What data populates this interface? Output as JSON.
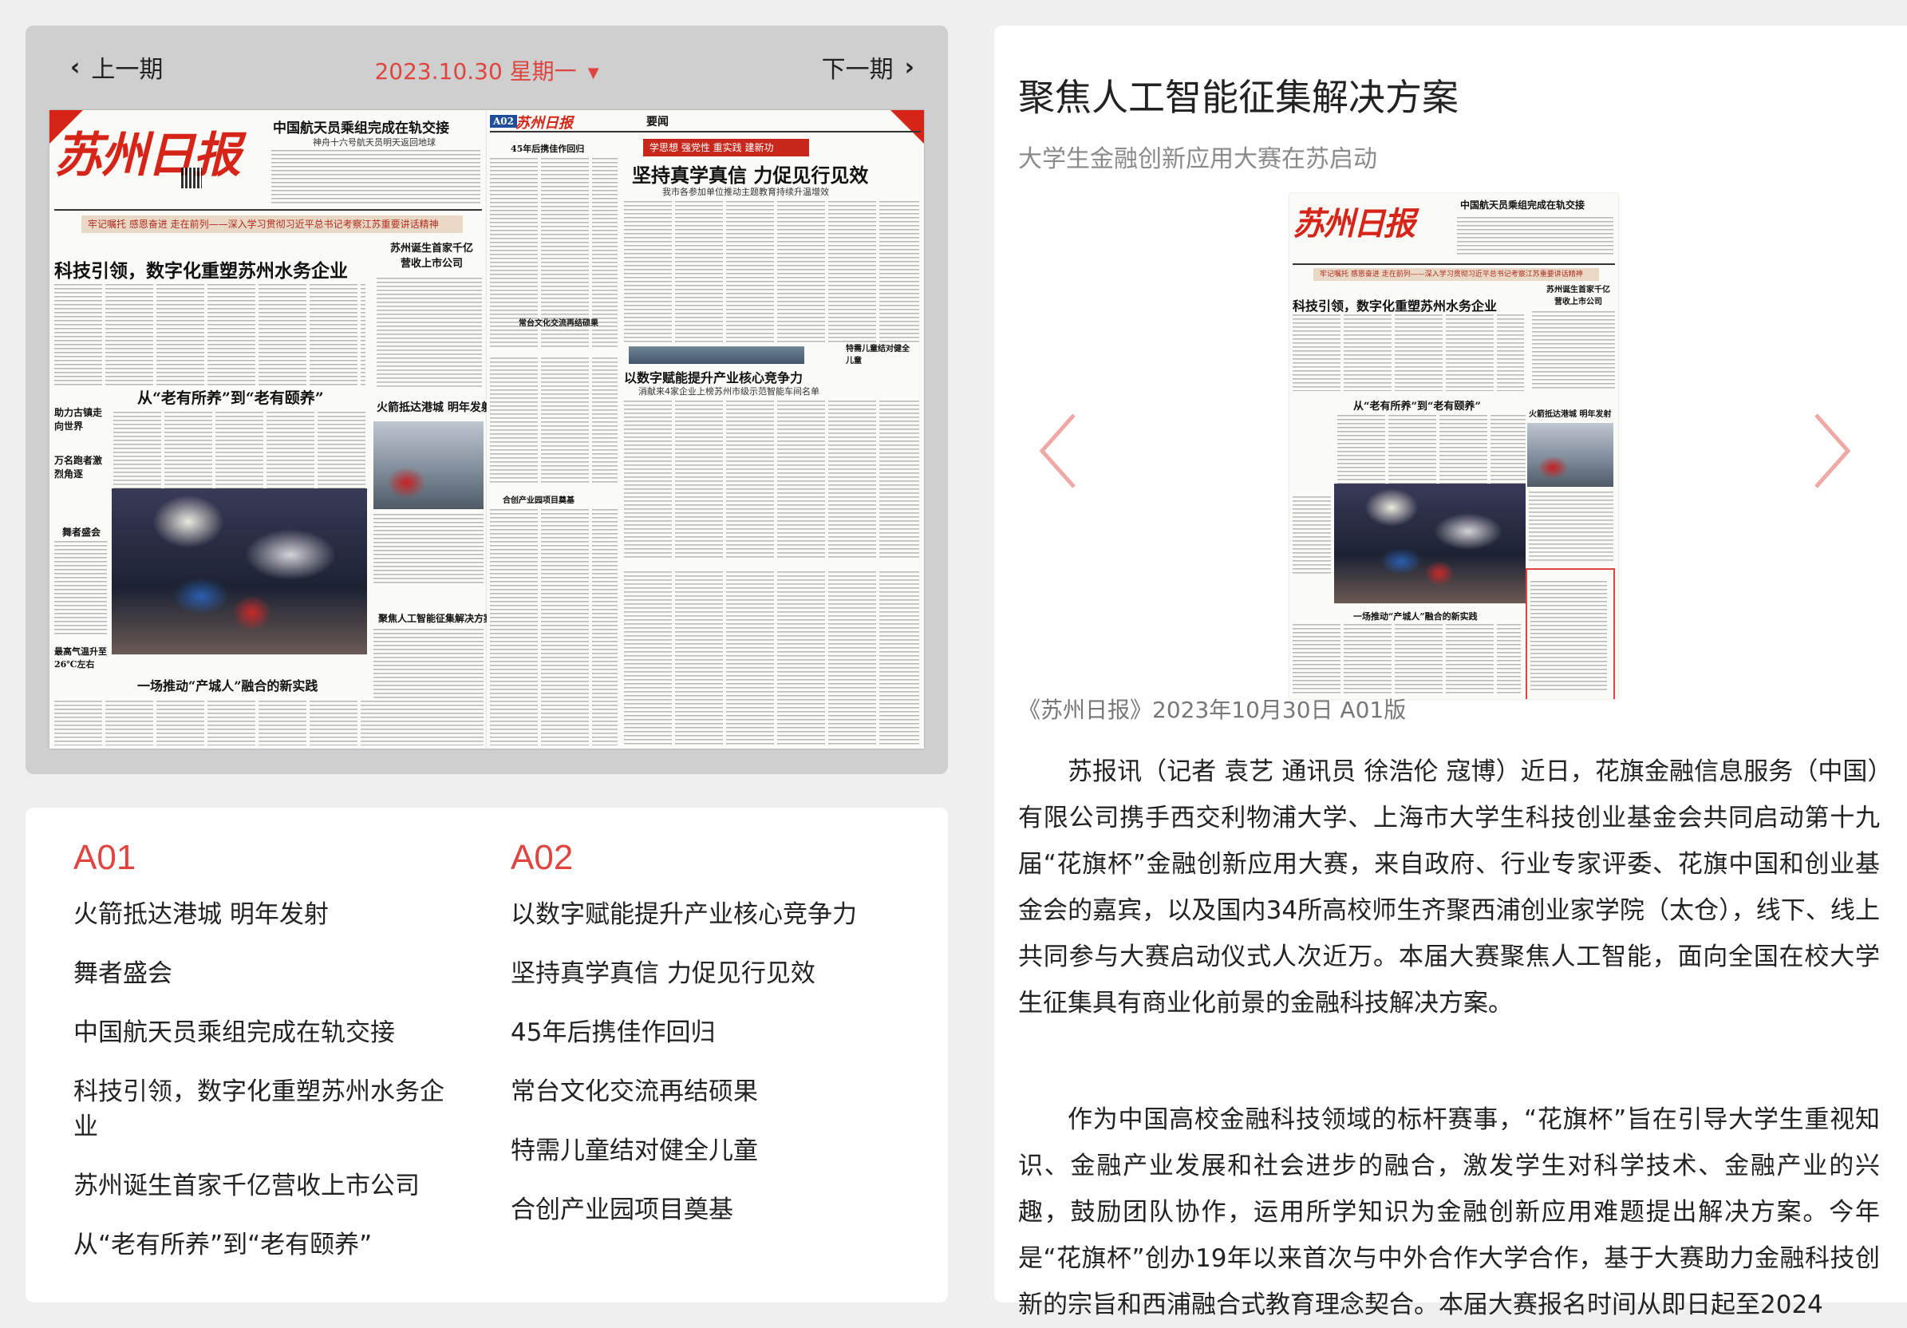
{
  "viewer": {
    "prev_label": "上一期",
    "next_label": "下一期",
    "date": "2023.10.30 星期一",
    "pages": [
      {
        "id": "A01",
        "masthead": "苏州日报",
        "top_headline": "中国航天员乘组完成在轨交接",
        "top_sub": "神舟十六号航天员明天返回地球",
        "banner": "牢记嘱托 感恩奋进 走在前列——深入学习贯彻习近平总书记考察江苏重要讲话精神",
        "lead_headline": "科技引领，数字化重塑苏州水务企业",
        "side_headline": "苏州诞生首家千亿营收上市公司",
        "mid_headline": "从“老有所养”到“老有颐养”",
        "rocket_headline": "火箭抵达港城 明年发射",
        "dance_label": "舞者盛会",
        "left_brief_1": "助力古镇走向世界",
        "left_brief_2": "万名跑者激烈角逐",
        "bottom_headline": "一场推动“产城人”融合的新实践",
        "bottom_right": "聚焦人工智能征集解决方案",
        "weather": "最高气温升至26℃左右"
      },
      {
        "id": "A02",
        "section": "要闻",
        "top_left": "45年后携佳作回归",
        "banner": "学思想 强党性 重实践 建新功",
        "lead_headline": "坚持真学真信 力促见行见效",
        "lead_sub": "我市各参加单位推动主题教育持续升温增效",
        "mid_headline": "以数字赋能提升产业核心竞争力",
        "mid_sub": "消献来4家企业上榜苏州市级示范智能车间名单",
        "left_mid": "常台文化交流再结硕果",
        "left_low": "合创产业园项目奠基",
        "right_small": "特需儿童结对健全儿童"
      }
    ]
  },
  "index": {
    "columns": [
      {
        "page": "A01",
        "items": [
          "火箭抵达港城 明年发射",
          "舞者盛会",
          "中国航天员乘组完成在轨交接",
          "科技引领，数字化重塑苏州水务企业",
          "苏州诞生首家千亿营收上市公司",
          "从“老有所养”到“老有颐养”"
        ]
      },
      {
        "page": "A02",
        "items": [
          "以数字赋能提升产业核心竞争力",
          "坚持真学真信 力促见行见效",
          "45年后携佳作回归",
          "常台文化交流再结硕果",
          "特需儿童结对健全儿童",
          "合创产业园项目奠基"
        ]
      }
    ]
  },
  "article": {
    "title": "聚焦人工智能征集解决方案",
    "subtitle": "大学生金融创新应用大赛在苏启动",
    "source": "《苏州日报》2023年10月30日 A01版",
    "paragraphs": [
      "苏报讯（记者 袁艺 通讯员 徐浩伦 寇博）近日，花旗金融信息服务（中国）有限公司携手西交利物浦大学、上海市大学生科技创业基金会共同启动第十九届“花旗杯”金融创新应用大赛，来自政府、行业专家评委、花旗中国和创业基金会的嘉宾，以及国内34所高校师生齐聚西浦创业家学院（太仓），线下、线上共同参与大赛启动仪式人次近万。本届大赛聚焦人工智能，面向全国在校大学生征集具有商业化前景的金融科技解决方案。",
      "作为中国高校金融科技领域的标杆赛事，“花旗杯”旨在引导大学生重视知识、金融产业发展和社会进步的融合，激发学生对科学技术、金融产业的兴趣，鼓励团队协作，运用所学知识为金融创新应用难题提出解决方案。今年是“花旗杯”创办19年以来首次与中外合作大学合作，基于大赛助力金融科技创新的宗旨和西浦融合式教育理念契合。本届大赛报名时间从即日起至2024"
    ]
  },
  "colors": {
    "accent": "#e0443f",
    "masthead_red": "#d62518",
    "panel_bg": "#ffffff",
    "viewer_bg": "#cfcfcf",
    "page_bg": "#efefef"
  },
  "icons": {
    "prev": "chevron-left-icon",
    "next": "chevron-right-icon",
    "date_dropdown": "caret-down-icon",
    "article_prev": "arrow-left-icon",
    "article_next": "arrow-right-icon"
  }
}
